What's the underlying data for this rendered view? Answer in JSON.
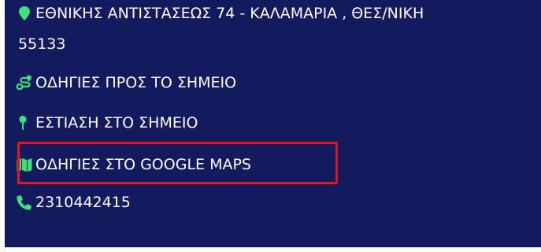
{
  "location": {
    "address_line": "ΕΘΝΙΚΗΣ ΑΝΤΙΣΤΑΣΕΩΣ 74 - ΚΑΛΑΜΑΡΙΑ , ΘΕΣ/ΝΙΚΗ",
    "postal_code": "55133",
    "directions_label": "ΟΔΗΓΙΕΣ ΠΡΟΣ ΤΟ ΣΗΜΕΙΟ",
    "focus_label": "ΕΣΤΙΑΣΗ ΣΤΟ ΣΗΜΕΙΟ",
    "google_maps_label": "ΟΔΗΓΙΕΣ ΣΤΟ GOOGLE MAPS",
    "phone": "2310442415"
  },
  "icons": {
    "address": "map-pin-icon",
    "directions": "route-icon",
    "focus": "pushpin-icon",
    "google_maps": "folded-map-icon",
    "phone": "phone-icon"
  },
  "colors": {
    "panel_background": "#141a5e",
    "text": "#ffffff",
    "icon_accent": "#3fe07a",
    "highlight_border": "#e8141c"
  }
}
